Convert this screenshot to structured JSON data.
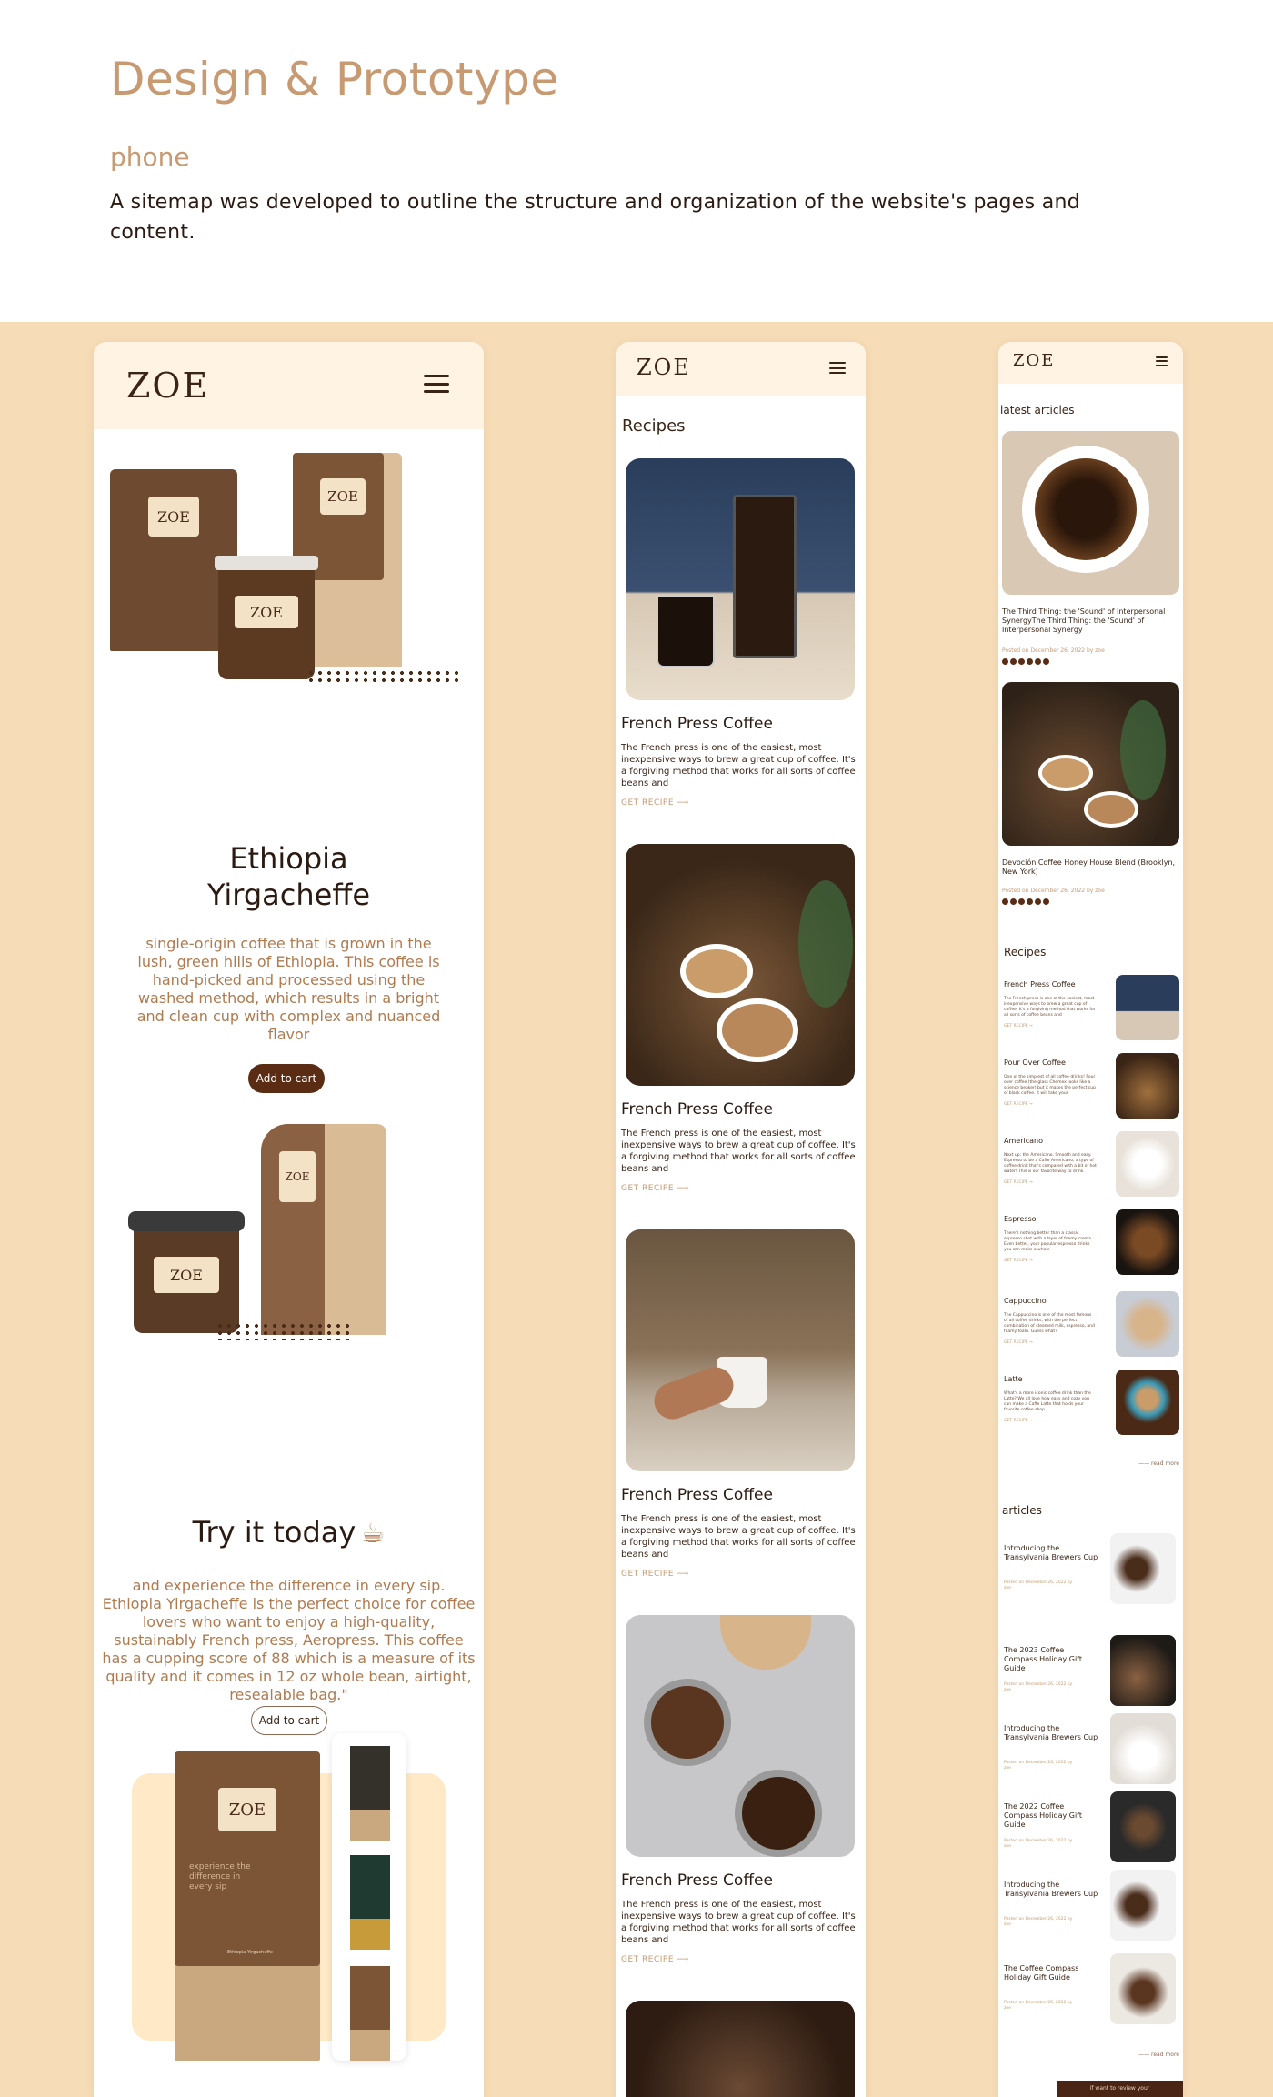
{
  "header": {
    "title": "Design & Prototype",
    "subtitle": "phone",
    "description": "A sitemap was developed to outline the structure and organization of the website's pages and content."
  },
  "colors": {
    "accent": "#c79a72",
    "band": "#f6dcb7",
    "dark_brown": "#5a2c14",
    "nav_bg": "#fff3e4"
  },
  "brand": {
    "logo": "ZOE"
  },
  "phone1": {
    "product_title_line1": "Ethiopia",
    "product_title_line2": "Yirgacheffe",
    "product_desc": "single-origin coffee that is grown in the lush, green hills of Ethiopia. This coffee is hand-picked and processed using the washed method, which results in a bright and clean cup with complex and nuanced flavor",
    "add_to_cart_1": "Add to cart",
    "try_title": "Try it today",
    "try_desc": "and experience the difference in every sip. Ethiopia Yirgacheffe is the perfect choice for coffee lovers who want to enjoy a high-quality, sustainably French press, Aeropress. This coffee has a cupping score of 88 which is a measure of its quality and it comes in 12 oz whole bean, airtight, resealable bag.\"",
    "add_to_cart_2": "Add to cart",
    "bag_label_text": "experience the difference in every sip",
    "bag_small_text": "Ethiopia Yirgacheffe"
  },
  "phone2": {
    "section_title": "Recipes",
    "cards": [
      {
        "title": "French Press Coffee",
        "desc": "The French press is one of the easiest, most inexpensive ways to brew a great cup of coffee. It's a forgiving method that works for all sorts of coffee beans and",
        "link": "GET RECIPE"
      },
      {
        "title": "French Press Coffee",
        "desc": "The French press is one of the easiest, most inexpensive ways to brew a great cup of coffee. It's a forgiving method that works for all sorts of coffee beans and",
        "link": "GET RECIPE"
      },
      {
        "title": "French Press Coffee",
        "desc": "The French press is one of the easiest, most inexpensive ways to brew a great cup of coffee. It's a forgiving method that works for all sorts of coffee beans and",
        "link": "GET RECIPE"
      },
      {
        "title": "French Press Coffee",
        "desc": "The French press is one of the easiest, most inexpensive ways to brew a great cup of coffee. It's a forgiving method that works for all sorts of coffee beans and",
        "link": "GET RECIPE"
      }
    ]
  },
  "phone3": {
    "latest_title": "latest articles",
    "latest": [
      {
        "title": "The Third Thing: the 'Sound' of Interpersonal SynergyThe Third Thing: the 'Sound' of Interpersonal Synergy",
        "meta": "Posted on December 26, 2022 by zoe"
      },
      {
        "title": "Devoción Coffee Honey House Blend (Brooklyn, New York)",
        "meta": "Posted on December 26, 2022 by zoe"
      }
    ],
    "recipes_title": "Recipes",
    "recipes": [
      {
        "title": "French Press Coffee",
        "desc": "The French press is one of the easiest, most inexpensive ways to brew a great cup of coffee. It's a forgiving method that works for all sorts of coffee beans and",
        "link": "GET RECIPE"
      },
      {
        "title": "Pour Over Coffee",
        "desc": "One of the simplest of all coffee drinks! Pour over coffee (the glass Chemex looks like a science beaker) but it makes the perfect cup of black coffee. It will take your",
        "link": "GET RECIPE"
      },
      {
        "title": "Americano",
        "desc": "Next up: the Americano. Smooth and easy. Espresso to be a Caffe Americano, a type of coffee drink that's compared with a bit of hot water! This is our favorite way to drink",
        "link": "GET RECIPE"
      },
      {
        "title": "Espresso",
        "desc": "There's nothing better than a classic espresso shot with a layer of foamy crema. Even better, your popular espresso drinks you can make a whole",
        "link": "GET RECIPE"
      },
      {
        "title": "Cappuccino",
        "desc": "The Cappuccino is one of the most famous of all coffee drinks, with the perfect combination of steamed milk, espresso, and foamy foam. Guess what?",
        "link": "GET RECIPE"
      },
      {
        "title": "Latte",
        "desc": "What's a more iconic coffee drink than the Latte? We all love how easy and cozy you can make a Caffe Latte that holds your favorite coffee shop.",
        "link": "GET RECIPE"
      }
    ],
    "read_more": "read more",
    "articles_title": "articles",
    "articles": [
      {
        "title": "Introducing the Transylvania Brewers Cup",
        "meta": "Posted on December 26, 2022 by zoe"
      },
      {
        "title": "The 2023 Coffee Compass Holiday Gift Guide",
        "meta": "Posted on December 26, 2022 by zoe"
      },
      {
        "title": "Introducing the Transylvania Brewers Cup",
        "meta": "Posted on December 26, 2022 by zoe"
      },
      {
        "title": "The 2022 Coffee Compass Holiday Gift Guide",
        "meta": "Posted on December 26, 2022 by zoe"
      },
      {
        "title": "Introducing the Transylvania Brewers Cup",
        "meta": "Posted on December 26, 2022 by zoe"
      },
      {
        "title": "The Coffee Compass Holiday Gift Guide",
        "meta": "Posted on December 26, 2022 by zoe"
      }
    ],
    "read_more_2": "read more",
    "review_cta": "if want to review your"
  }
}
